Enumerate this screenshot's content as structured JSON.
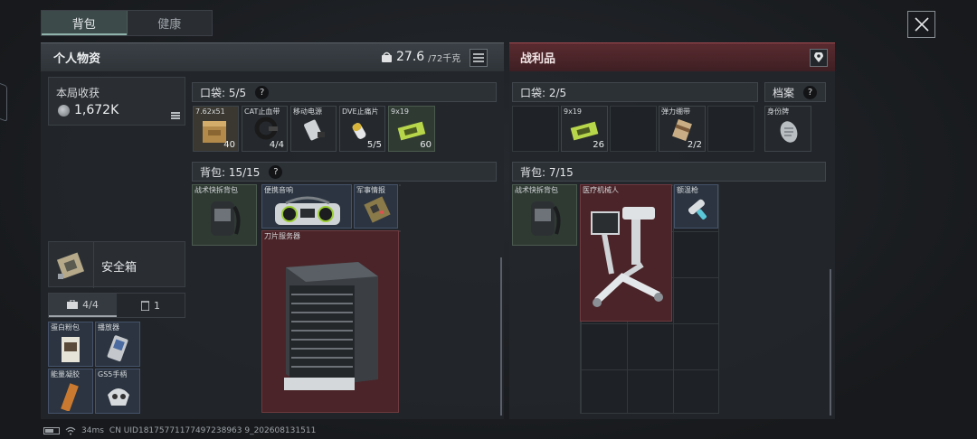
{
  "tabs": [
    "背包",
    "健康"
  ],
  "left_panel": {
    "title": "个人物资",
    "weight": "27.6",
    "weight_max": "/72千克",
    "harvest_label": "本局收获",
    "harvest_value": "1,672K",
    "pocket_label": "口袋: 5/5",
    "backpack_label": "背包: 15/15",
    "safe_label": "安全箱",
    "subtab_a": "4/4",
    "subtab_b": "1",
    "pocket_items": [
      {
        "name": "7.62x51",
        "count": "40",
        "icon": "ammo-box-icon"
      },
      {
        "name": "CAT止血带",
        "count": "4/4",
        "icon": "tourniquet-icon"
      },
      {
        "name": "移动电源",
        "count": "",
        "icon": "power-bank-icon"
      },
      {
        "name": "DVE止痛片",
        "count": "5/5",
        "icon": "pill-icon"
      },
      {
        "name": "9x19",
        "count": "60",
        "icon": "ammo-pack-icon"
      }
    ],
    "backpack_items": [
      {
        "name": "战术快拆背包",
        "icon": "backpack-icon"
      },
      {
        "name": "便携音响",
        "icon": "boombox-icon"
      },
      {
        "name": "军事情报",
        "icon": "circuit-board-icon"
      },
      {
        "name": "刀片服务器",
        "icon": "blade-server-icon"
      }
    ],
    "safe_items": [
      {
        "name": "蛋白粉包",
        "icon": "protein-pack-icon"
      },
      {
        "name": "播放器",
        "icon": "player-icon"
      },
      {
        "name": "能量凝胶",
        "icon": "energy-gel-icon"
      },
      {
        "name": "GS5手柄",
        "icon": "gamepad-icon"
      }
    ]
  },
  "right_panel": {
    "title": "战利品",
    "pocket_label": "口袋: 2/5",
    "archive_label": "档案",
    "backpack_label": "背包: 7/15",
    "pocket_items": [
      {
        "name": "9x19",
        "count": "26",
        "icon": "ammo-pack-icon"
      },
      {
        "name": "弹力绷带",
        "count": "2/2",
        "icon": "bandage-icon"
      }
    ],
    "archive_item": {
      "name": "身份牌",
      "icon": "dog-tag-icon"
    },
    "backpack_items": [
      {
        "name": "战术快拆背包",
        "icon": "backpack-icon"
      },
      {
        "name": "医疗机械人",
        "icon": "medical-robot-icon"
      },
      {
        "name": "额温枪",
        "icon": "thermometer-gun-icon"
      }
    ]
  },
  "status": {
    "ping": "34ms",
    "uid": "CN UID18175771177497238963 9_202608131511"
  }
}
